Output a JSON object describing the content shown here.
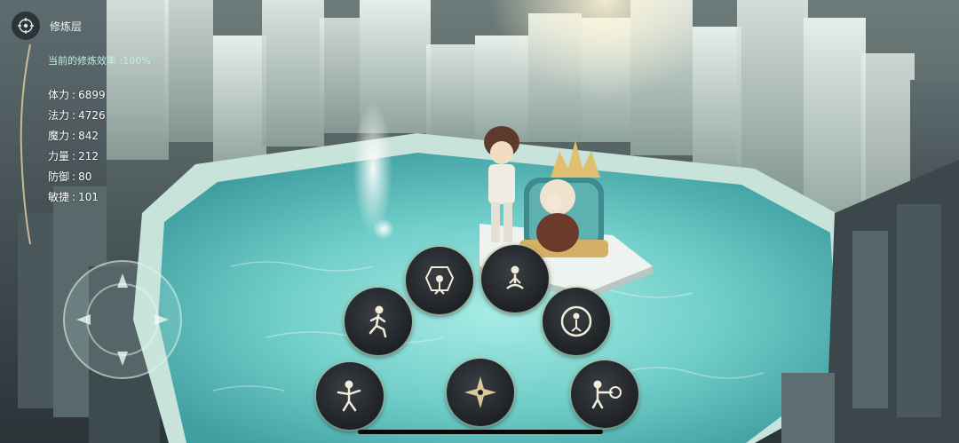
{
  "header": {
    "title": "修炼层",
    "compass_icon": "compass-icon"
  },
  "efficiency": "当前的修炼效率 :100%",
  "stats": [
    {
      "label": "体力",
      "value": "6899"
    },
    {
      "label": "法力",
      "value": "4726"
    },
    {
      "label": "魔力",
      "value": "842"
    },
    {
      "label": "力量",
      "value": "212"
    },
    {
      "label": "防御",
      "value": "80"
    },
    {
      "label": "敏捷",
      "value": "101"
    }
  ],
  "skills": [
    {
      "id": "shield-guard",
      "icon": "shield-figure-icon"
    },
    {
      "id": "meditate",
      "icon": "meditate-figure-icon"
    },
    {
      "id": "run",
      "icon": "running-figure-icon"
    },
    {
      "id": "target-circle",
      "icon": "target-figure-icon"
    },
    {
      "id": "dodge",
      "icon": "dodge-figure-icon"
    },
    {
      "id": "center-star",
      "icon": "four-point-star-icon"
    },
    {
      "id": "archer",
      "icon": "archer-figure-icon"
    }
  ],
  "colors": {
    "pool_water": "#7fd6d2",
    "rock_light": "#c9d9d2",
    "gold_accent": "#e0c070",
    "button_bg": "#1e2226"
  }
}
